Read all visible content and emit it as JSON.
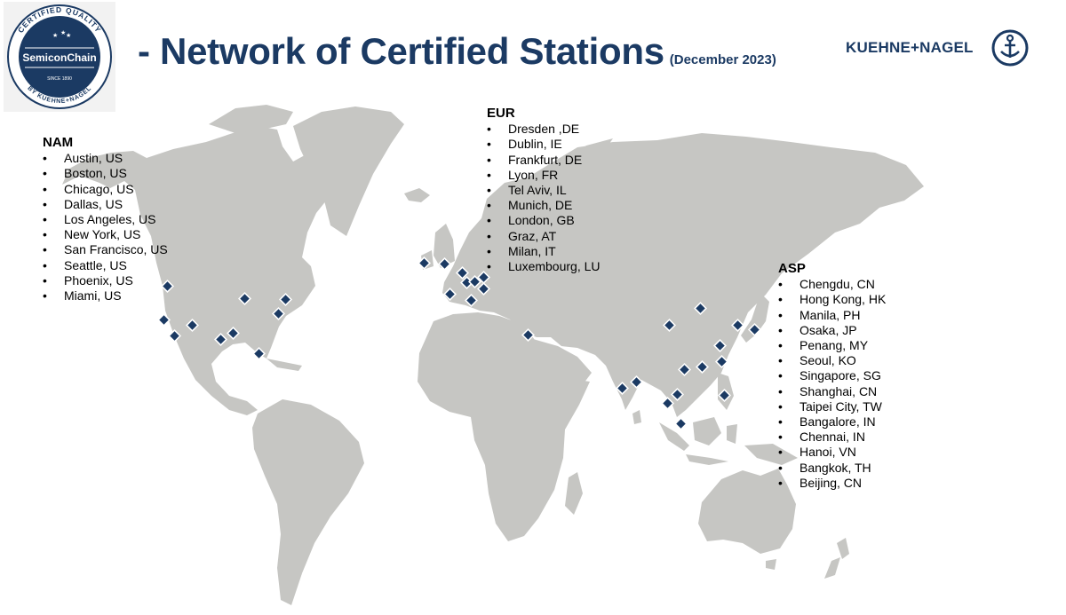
{
  "header": {
    "title": "- Network of Certified Stations",
    "date": "(December 2023)"
  },
  "badge": {
    "top_text": "CERTIFIED QUALITY",
    "name": "SemiconChain",
    "since": "SINCE 1890",
    "bottom_text": "BY KUEHNE+NAGEL"
  },
  "brand": {
    "name": "KUEHNE+NAGEL",
    "color": "#1b3a63"
  },
  "colors": {
    "land": "#c6c6c3",
    "marker": "#1b3a63",
    "title": "#1b3a63"
  },
  "regions": {
    "nam": {
      "title": "NAM",
      "stations": [
        "Austin, US",
        "Boston, US",
        "Chicago, US",
        "Dallas, US",
        "Los Angeles, US",
        "New York, US",
        "San Francisco, US",
        "Seattle, US",
        "Phoenix, US",
        "Miami, US"
      ]
    },
    "eur": {
      "title": "EUR",
      "stations": [
        "Dresden ,DE",
        "Dublin, IE",
        "Frankfurt, DE",
        "Lyon, FR",
        "Tel Aviv, IL",
        "Munich, DE",
        "London, GB",
        "Graz, AT",
        "Milan, IT",
        "Luxembourg, LU"
      ]
    },
    "asp": {
      "title": "ASP",
      "stations": [
        "Chengdu, CN",
        "Hong Kong, HK",
        "Manila, PH",
        "Osaka, JP",
        "Penang, MY",
        "Seoul, KO",
        "Singapore, SG",
        "Shanghai, CN",
        "Taipei City, TW",
        "Bangalore, IN",
        "Chennai, IN",
        "Hanoi, VN",
        "Bangkok, TH",
        "Beijing, CN"
      ]
    }
  },
  "bullet": "•"
}
